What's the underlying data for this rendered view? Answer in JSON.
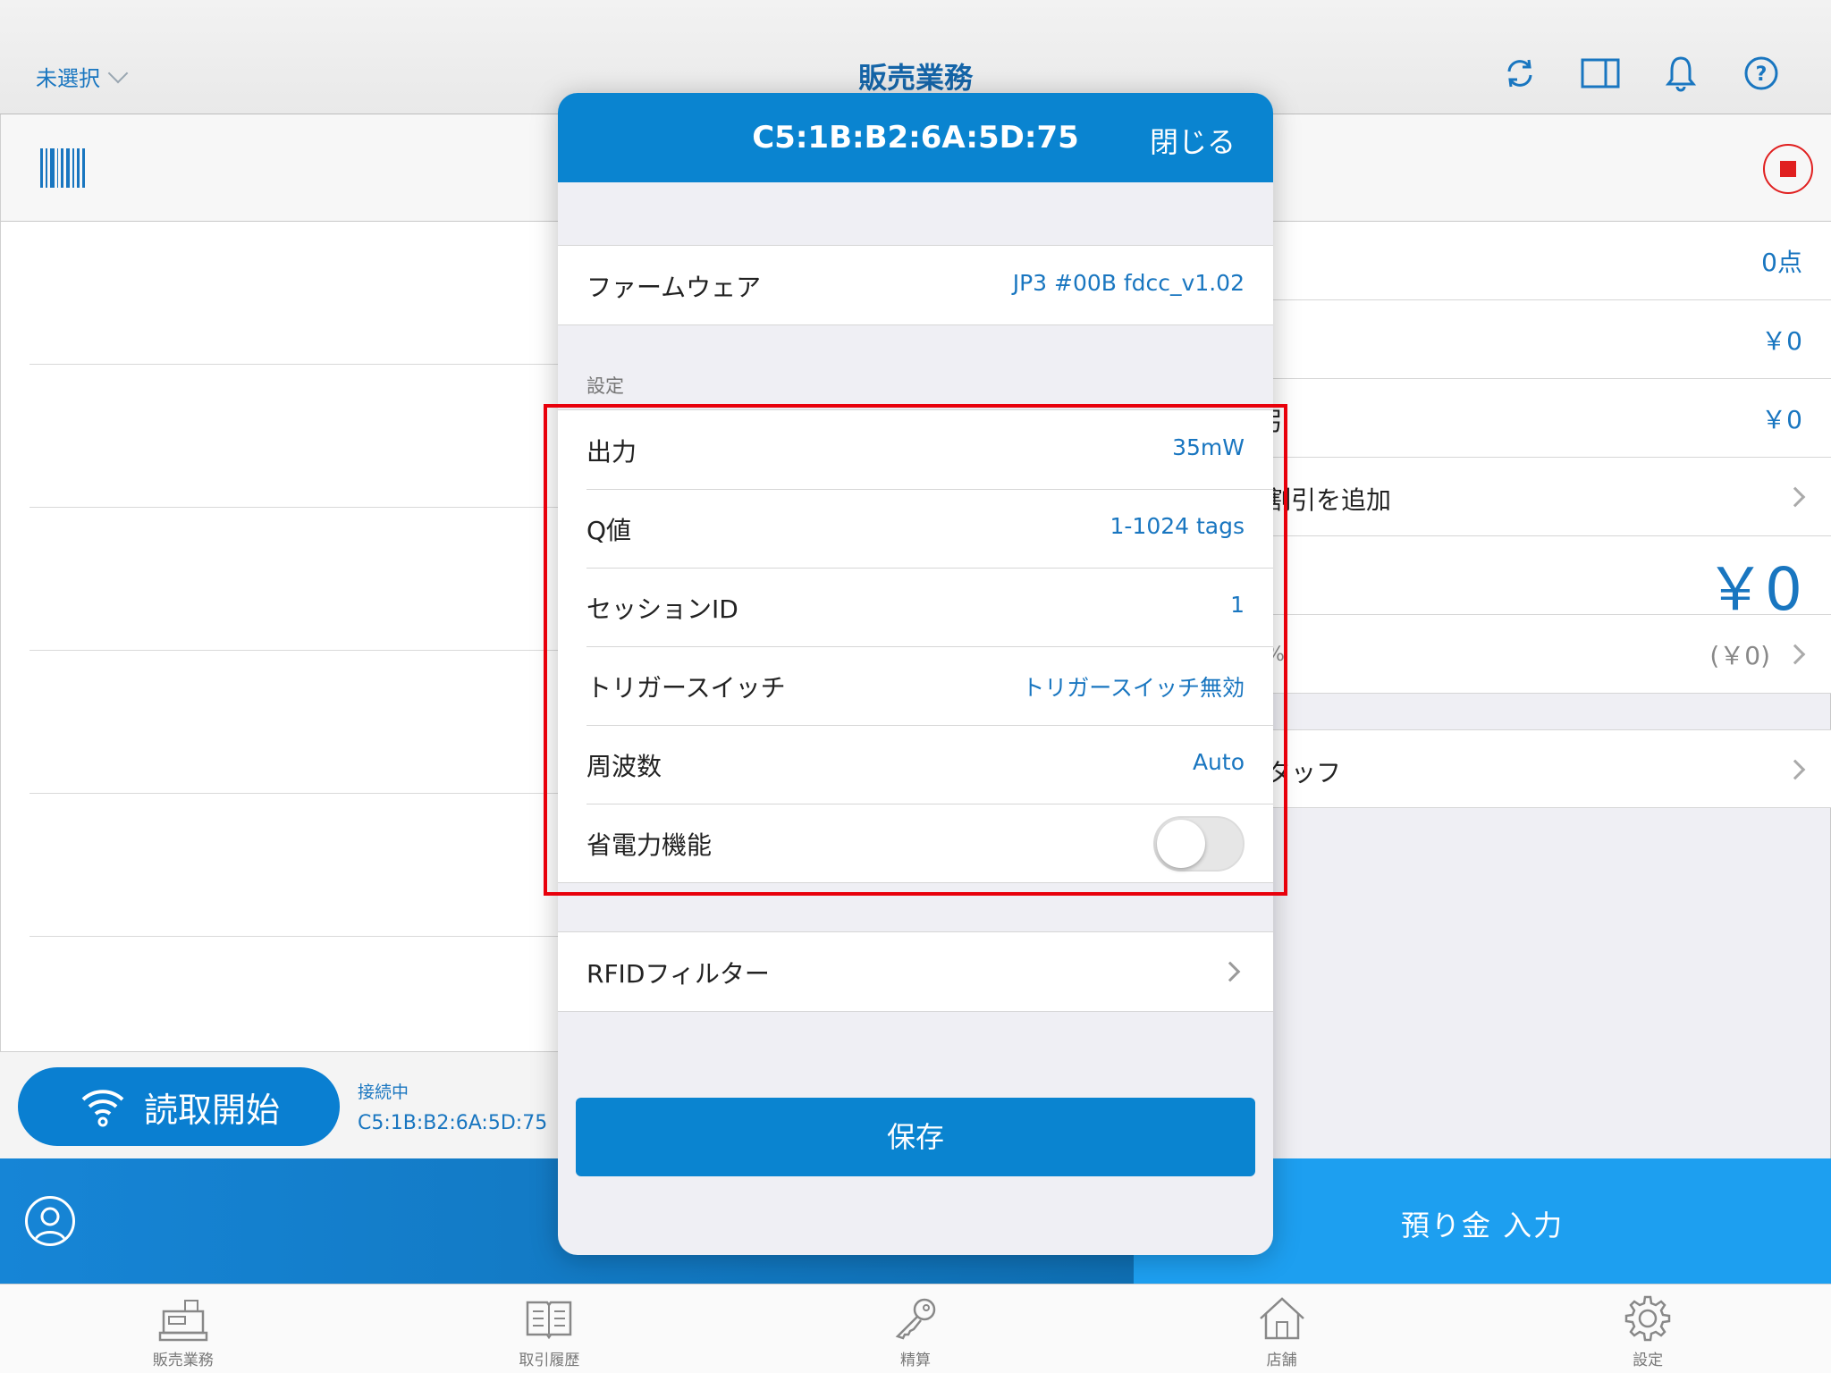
{
  "header": {
    "store_select": "未選択",
    "title": "販売業務",
    "icons": [
      "sync-icon",
      "split-view-icon",
      "bell-icon",
      "help-icon"
    ]
  },
  "left": {
    "barcode_icon": "barcode-icon",
    "reader": {
      "start_label": "読取開始",
      "status_label": "接続中",
      "device_id": "C5:1B:B2:6A:5D:75"
    }
  },
  "right": {
    "rows": [
      {
        "label": "",
        "value": "0点"
      },
      {
        "label": "",
        "value": "￥0"
      },
      {
        "label": "引",
        "value": "￥0"
      },
      {
        "label": "割引を追加",
        "value": ""
      },
      {
        "label": "",
        "value": "￥0"
      },
      {
        "label": "%",
        "value": "(￥0)"
      },
      {
        "label": "タッフ",
        "value": ""
      }
    ],
    "deposit_label": "預り金 入力"
  },
  "modal": {
    "title": "C5:1B:B2:6A:5D:75",
    "close_label": "閉じる",
    "firmware": {
      "label": "ファームウェア",
      "value": "JP3  #00B fdcc_v1.02"
    },
    "section_label": "設定",
    "settings": [
      {
        "label": "出力",
        "value": "35mW"
      },
      {
        "label": "Q値",
        "value": "1-1024 tags"
      },
      {
        "label": "セッションID",
        "value": "1"
      },
      {
        "label": "トリガースイッチ",
        "value": "トリガースイッチ無効"
      },
      {
        "label": "周波数",
        "value": "Auto"
      }
    ],
    "power_saving": {
      "label": "省電力機能",
      "enabled": false
    },
    "rfid_filter_label": "RFIDフィルター",
    "save_label": "保存"
  },
  "tabs": [
    {
      "label": "販売業務",
      "icon": "register-icon"
    },
    {
      "label": "取引履歴",
      "icon": "book-icon"
    },
    {
      "label": "精算",
      "icon": "key-icon"
    },
    {
      "label": "店舗",
      "icon": "house-icon"
    },
    {
      "label": "設定",
      "icon": "gear-icon"
    }
  ],
  "colors": {
    "accent": "#0a84d0",
    "highlight": "#e8000b",
    "link": "#1976c0"
  }
}
